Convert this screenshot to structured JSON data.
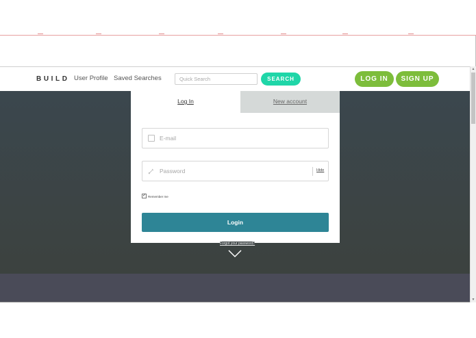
{
  "header": {
    "brand": "BUILD",
    "nav": {
      "profile": "User Profile",
      "saved": "Saved Searches"
    },
    "search": {
      "placeholder": "Quick Search",
      "button": "SEARCH"
    },
    "auth": {
      "login": "LOG IN",
      "signup": "SIGN UP"
    }
  },
  "card": {
    "tabs": {
      "login": "Log In",
      "new_account": "New account"
    },
    "email_placeholder": "E-mail",
    "password_placeholder": "Password",
    "show_toggle": "Hide",
    "remember_label": "Remember me",
    "remember_checked": true,
    "submit": "Login"
  },
  "forgot_link": "Forgot your password?",
  "icons": {
    "email": "checkbox-square-icon",
    "password": "key-icon",
    "scroll": "chevron-down-icon"
  },
  "colors": {
    "search_button": "#1fd6a8",
    "auth_buttons": "#7dbd3b",
    "submit_button": "#2e8596",
    "hero": "#3b474e"
  }
}
